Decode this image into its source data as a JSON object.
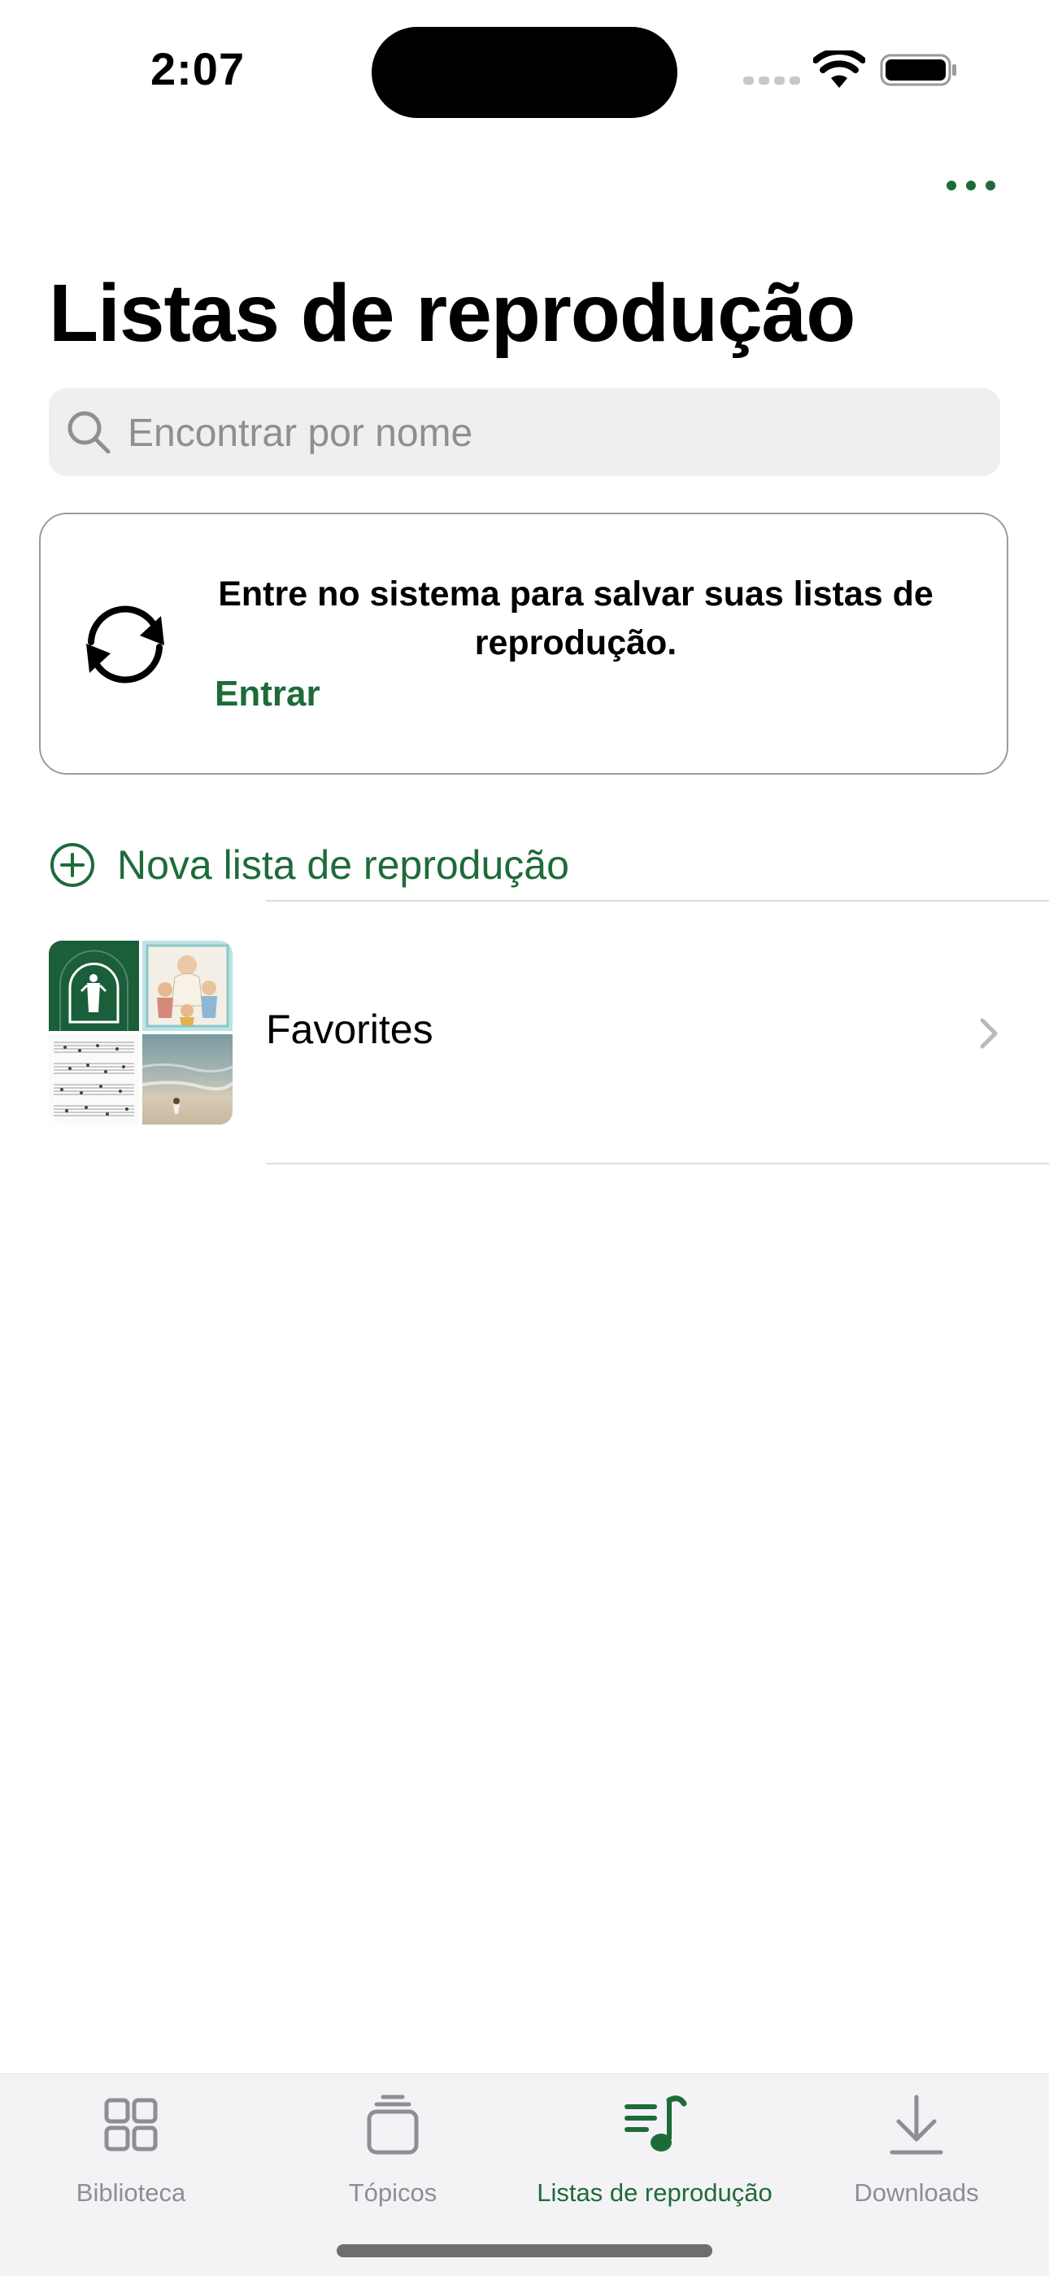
{
  "status_bar": {
    "time": "2:07"
  },
  "header": {
    "title": "Listas de reprodução"
  },
  "search": {
    "placeholder": "Encontrar por nome",
    "value": ""
  },
  "signin_card": {
    "message": "Entre no sistema para salvar suas listas de reprodução.",
    "link_label": "Entrar"
  },
  "new_playlist": {
    "label": "Nova lista de reprodução"
  },
  "playlists": [
    {
      "name": "Favorites"
    }
  ],
  "tab_bar": {
    "active_index": 2,
    "tabs": [
      {
        "label": "Biblioteca",
        "icon": "grid-icon"
      },
      {
        "label": "Tópicos",
        "icon": "stack-icon"
      },
      {
        "label": "Listas de reprodução",
        "icon": "playlist-music-icon"
      },
      {
        "label": "Downloads",
        "icon": "download-icon"
      }
    ]
  },
  "colors": {
    "accent": "#1e6b3a",
    "inactive": "#8e8e93",
    "search_bg": "#efefef"
  }
}
